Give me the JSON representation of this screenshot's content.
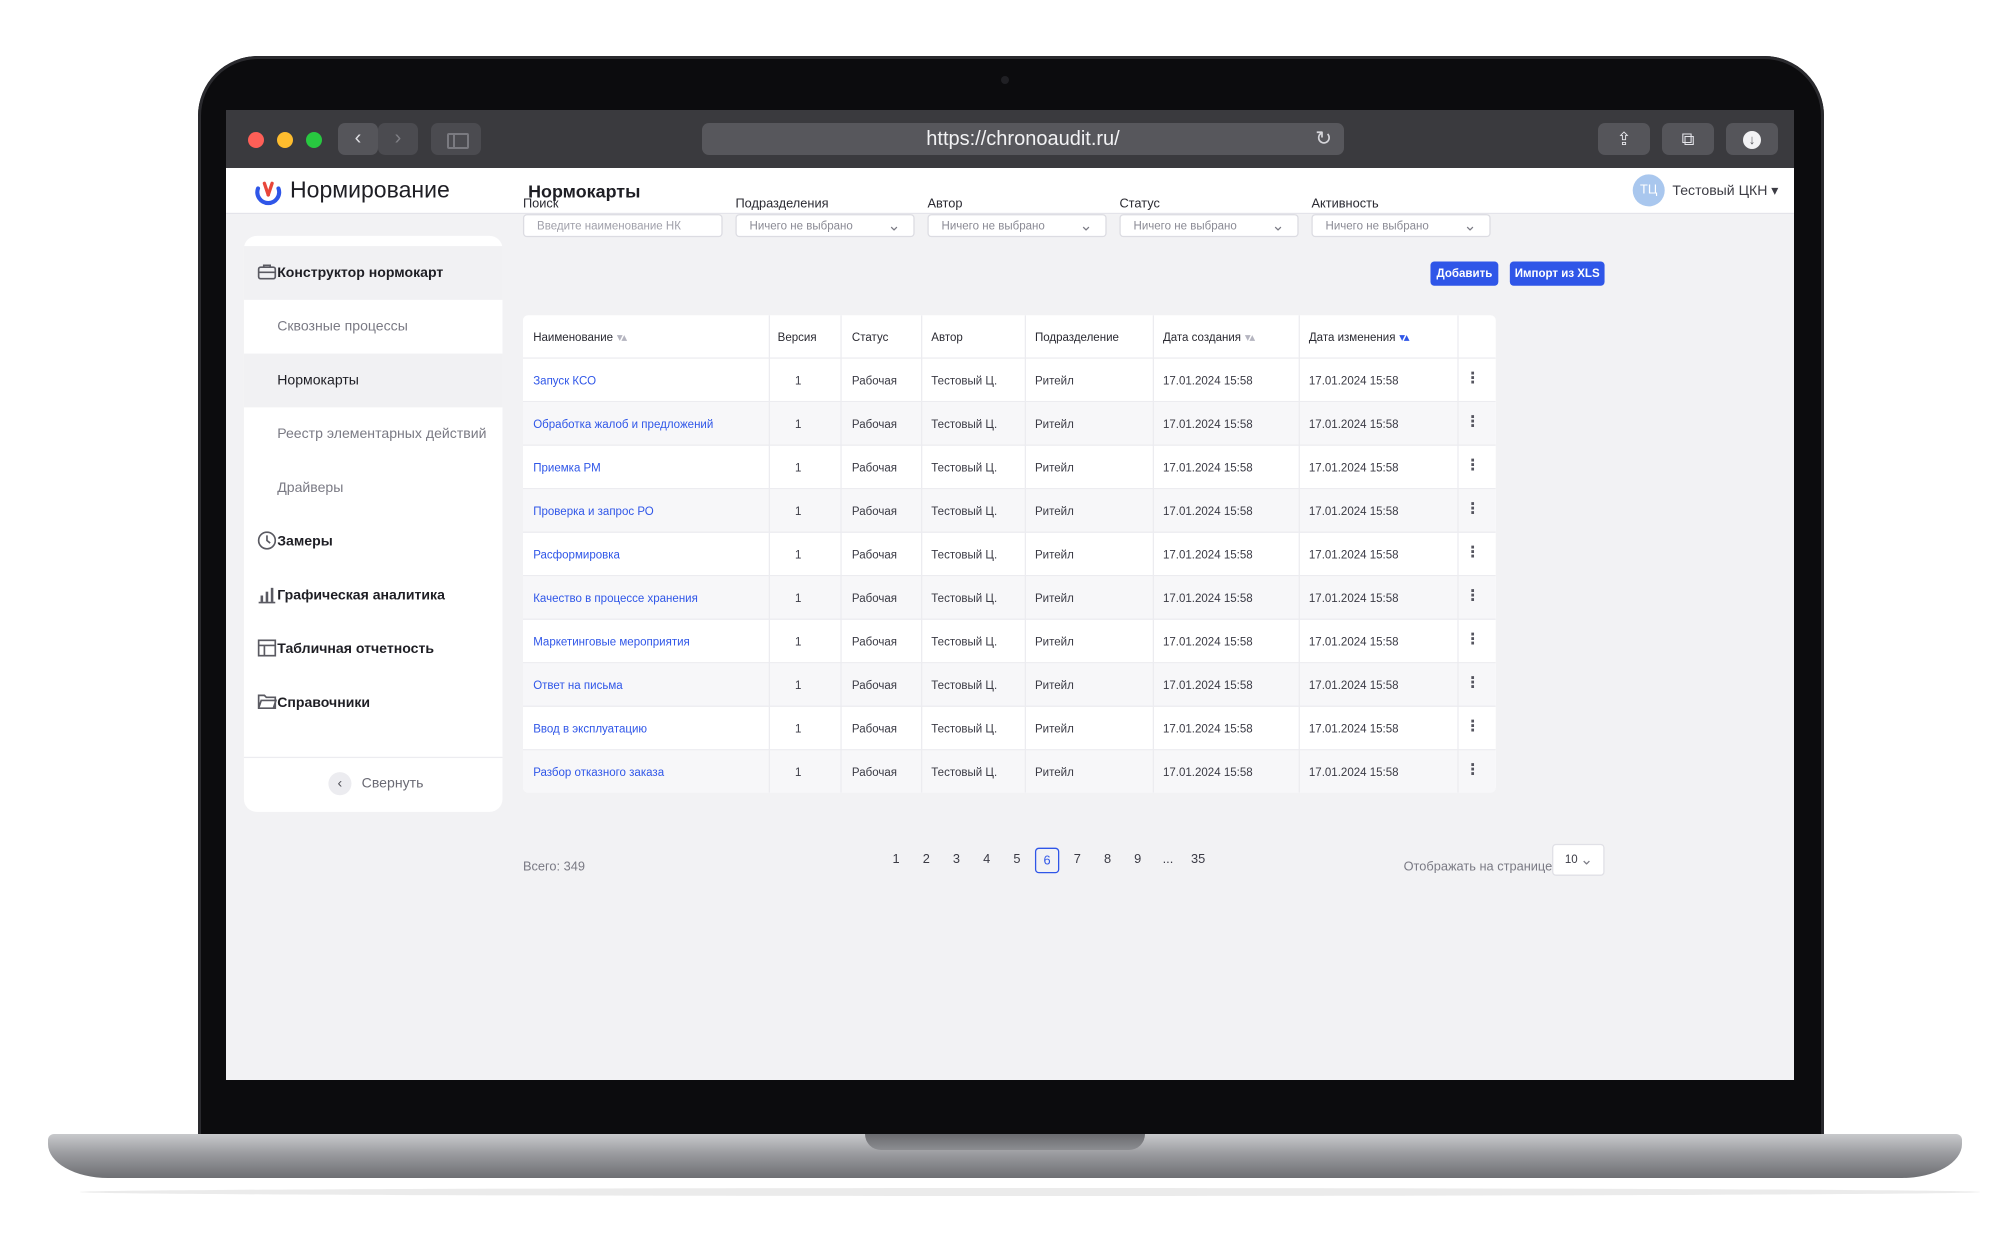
{
  "browser": {
    "url": "https://chronoaudit.ru/"
  },
  "header": {
    "app_name": "Нормирование",
    "page_title": "Нормокарты",
    "avatar_initials": "ТЦ",
    "user_name": "Тестовый ЦКН ▾"
  },
  "sidebar": {
    "items": [
      {
        "label": "Конструктор нормокарт",
        "icon": "briefcase-icon"
      },
      {
        "label": "Сквозные процессы"
      },
      {
        "label": "Нормокарты"
      },
      {
        "label": "Реестр элементарных действий"
      },
      {
        "label": "Драйверы"
      },
      {
        "label": "Замеры",
        "icon": "clock-icon"
      },
      {
        "label": "Графическая аналитика",
        "icon": "chart-icon"
      },
      {
        "label": "Табличная отчетность",
        "icon": "table-icon"
      },
      {
        "label": "Справочники",
        "icon": "folder-icon"
      }
    ],
    "collapse_label": "Свернуть"
  },
  "filters": {
    "search": {
      "label": "Поиск",
      "placeholder": "Введите наименование НК"
    },
    "department": {
      "label": "Подразделения",
      "value": "Ничего не выбрано"
    },
    "author": {
      "label": "Автор",
      "value": "Ничего не выбрано"
    },
    "status": {
      "label": "Статус",
      "value": "Ничего не выбрано"
    },
    "activity": {
      "label": "Активность",
      "value": "Ничего не выбрано"
    }
  },
  "actions": {
    "add_label": "Добавить",
    "import_label": "Импорт из XLS"
  },
  "table": {
    "columns": [
      "Наименование",
      "Версия",
      "Статус",
      "Автор",
      "Подразделение",
      "Дата создания",
      "Дата изменения"
    ],
    "rows": [
      {
        "name": "Запуск КСО",
        "version": "1",
        "status": "Рабочая",
        "author": "Тестовый Ц.",
        "department": "Ритейл",
        "created": "17.01.2024 15:58",
        "modified": "17.01.2024 15:58"
      },
      {
        "name": "Обработка жалоб и предложений",
        "version": "1",
        "status": "Рабочая",
        "author": "Тестовый Ц.",
        "department": "Ритейл",
        "created": "17.01.2024 15:58",
        "modified": "17.01.2024 15:58"
      },
      {
        "name": "Приемка РМ",
        "version": "1",
        "status": "Рабочая",
        "author": "Тестовый Ц.",
        "department": "Ритейл",
        "created": "17.01.2024 15:58",
        "modified": "17.01.2024 15:58"
      },
      {
        "name": "Проверка и запрос РО",
        "version": "1",
        "status": "Рабочая",
        "author": "Тестовый Ц.",
        "department": "Ритейл",
        "created": "17.01.2024 15:58",
        "modified": "17.01.2024 15:58"
      },
      {
        "name": "Расформировка",
        "version": "1",
        "status": "Рабочая",
        "author": "Тестовый Ц.",
        "department": "Ритейл",
        "created": "17.01.2024 15:58",
        "modified": "17.01.2024 15:58"
      },
      {
        "name": "Качество в процессе хранения",
        "version": "1",
        "status": "Рабочая",
        "author": "Тестовый Ц.",
        "department": "Ритейл",
        "created": "17.01.2024 15:58",
        "modified": "17.01.2024 15:58"
      },
      {
        "name": "Маркетинговые мероприятия",
        "version": "1",
        "status": "Рабочая",
        "author": "Тестовый Ц.",
        "department": "Ритейл",
        "created": "17.01.2024 15:58",
        "modified": "17.01.2024 15:58"
      },
      {
        "name": "Ответ на письма",
        "version": "1",
        "status": "Рабочая",
        "author": "Тестовый Ц.",
        "department": "Ритейл",
        "created": "17.01.2024 15:58",
        "modified": "17.01.2024 15:58"
      },
      {
        "name": "Ввод в эксплуатацию",
        "version": "1",
        "status": "Рабочая",
        "author": "Тестовый Ц.",
        "department": "Ритейл",
        "created": "17.01.2024 15:58",
        "modified": "17.01.2024 15:58"
      },
      {
        "name": "Разбор отказного заказа",
        "version": "1",
        "status": "Рабочая",
        "author": "Тестовый Ц.",
        "department": "Ритейл",
        "created": "17.01.2024 15:58",
        "modified": "17.01.2024 15:58"
      }
    ]
  },
  "pagination": {
    "total": "Всего: 349",
    "pages": [
      "1",
      "2",
      "3",
      "4",
      "5",
      "6",
      "7",
      "8",
      "9",
      "...",
      "35"
    ],
    "current": "6",
    "per_page_label": "Отображать на странице:",
    "per_page_value": "10"
  },
  "colors": {
    "accent": "#2f56e8",
    "traffic_red": "#fe5f57",
    "traffic_yellow": "#febc2e",
    "traffic_green": "#28c840"
  }
}
